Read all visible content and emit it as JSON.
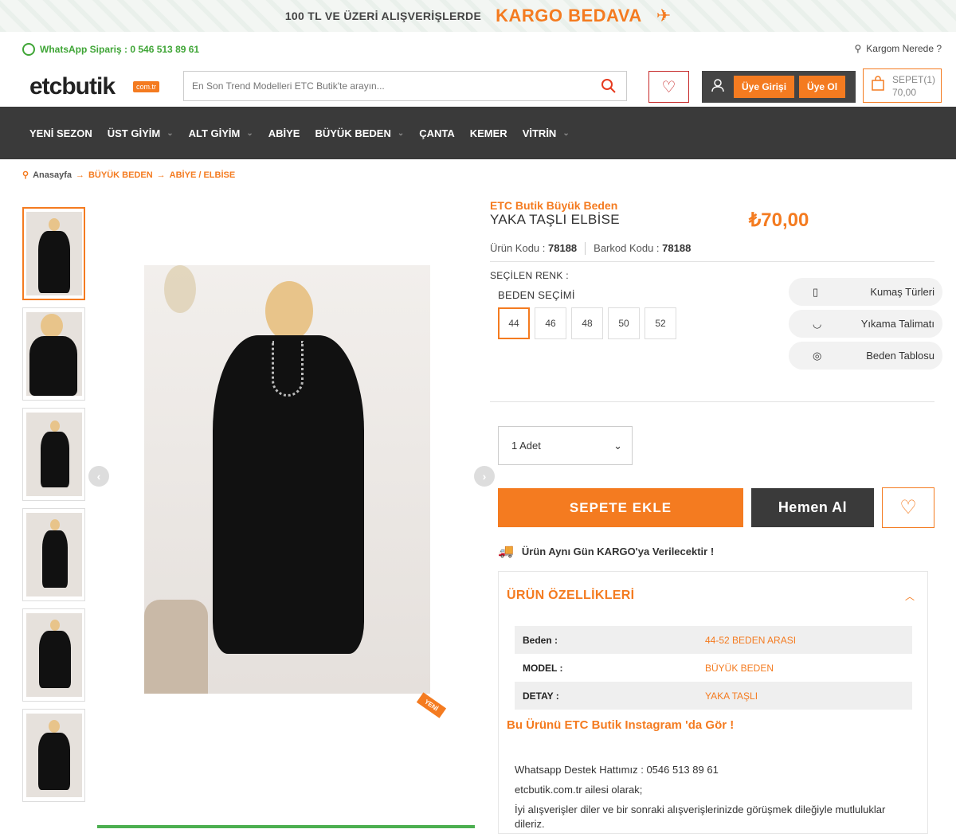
{
  "topbar": {
    "promo_text": "100 TL VE ÜZERİ ALIŞVERİŞLERDE",
    "promo_highlight": "KARGO BEDAVA"
  },
  "header": {
    "whatsapp": "WhatsApp Sipariş : 0 546 513 89 61",
    "kargom": "Kargom Nerede ?",
    "logo_text": "etcbutik",
    "logo_tag": "com.tr",
    "search_placeholder": "En Son Trend Modelleri ETC Butik'te arayın...",
    "login": "Üye Girişi",
    "register": "Üye Ol",
    "cart_label": "SEPET(1)",
    "cart_total": "70,00"
  },
  "nav": [
    "YENİ SEZON",
    "ÜST GİYİM",
    "ALT GİYİM",
    "ABİYE",
    "BÜYÜK BEDEN",
    "ÇANTA",
    "KEMER",
    "VİTRİN"
  ],
  "breadcrumb": [
    "Anasayfa",
    "BÜYÜK BEDEN",
    "ABİYE / ELBİSE"
  ],
  "gallery": {
    "new_badge": "YENİ"
  },
  "product": {
    "brand": "ETC Butik Büyük Beden",
    "name": "YAKA TAŞLI ELBİSE",
    "price": "₺70,00",
    "code_label": "Ürün Kodu :",
    "code": "78188",
    "barcode_label": "Barkod Kodu :",
    "barcode": "78188",
    "selected_color": "SEÇİLEN RENK :",
    "size_title": "BEDEN SEÇİMİ",
    "sizes": [
      "44",
      "46",
      "48",
      "50",
      "52"
    ],
    "selected_size": "44",
    "quantity": "1 Adet",
    "add_to_cart": "SEPETE EKLE",
    "buy_now": "Hemen Al",
    "shipping_note": "Ürün Aynı Gün KARGO'ya Verilecektir !"
  },
  "side_links": [
    "Kumaş Türleri",
    "Yıkama Talimatı",
    "Beden Tablosu"
  ],
  "features": {
    "title": "ÜRÜN ÖZELLİKLERİ",
    "rows": [
      {
        "key": "Beden :",
        "value": "44-52 BEDEN ARASI"
      },
      {
        "key": "MODEL :",
        "value": "BÜYÜK BEDEN"
      },
      {
        "key": "DETAY :",
        "value": "YAKA TAŞLI"
      }
    ],
    "instagram": "Bu Ürünü ETC Butik Instagram 'da Gör !",
    "support": "Whatsapp Destek Hattımız : 0546 513 89 61",
    "family": "etcbutik.com.tr ailesi olarak;",
    "wish": "İyi alışverişler diler ve bir sonraki alışverişlerinizde görüşmek dileğiyle mutluluklar dileriz."
  },
  "colors": {
    "accent": "#f47b20",
    "dark": "#3a3a3a",
    "whatsapp": "#3fa536"
  }
}
